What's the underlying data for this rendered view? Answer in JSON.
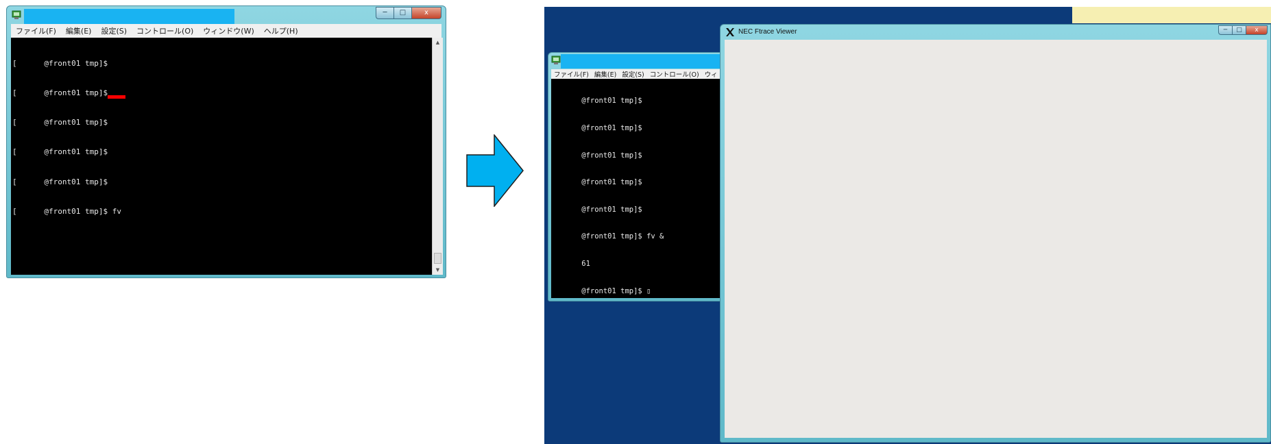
{
  "terminal_window": {
    "menu": [
      "ファイル(F)",
      "編集(E)",
      "設定(S)",
      "コントロール(O)",
      "ウィンドウ(W)",
      "ヘルプ(H)"
    ],
    "lines": [
      "[      @front01 tmp]$",
      "[      @front01 tmp]$",
      "[      @front01 tmp]$",
      "[      @front01 tmp]$",
      "[      @front01 tmp]$",
      "[      @front01 tmp]$ fv"
    ],
    "controls": {
      "minimize": "─",
      "maximize": "□",
      "close": "x"
    },
    "scroll_up": "▲",
    "scroll_down": "▼",
    "highlight_color": "#ff0000"
  },
  "arrow": {
    "color": "#00b0f0"
  },
  "desktop": {
    "background": "#0c3a79"
  },
  "back_terminal_window": {
    "menu": [
      "ファイル(F)",
      "編集(E)",
      "設定(S)",
      "コントロール(O)",
      "ウィ"
    ],
    "lines": [
      "       @front01 tmp]$",
      "       @front01 tmp]$",
      "       @front01 tmp]$",
      "       @front01 tmp]$",
      "       @front01 tmp]$",
      "       @front01 tmp]$ fv &",
      "       61",
      "       @front01 tmp]$ ▯"
    ]
  },
  "viewer_window": {
    "title": "NEC Ftrace Viewer",
    "controls": {
      "minimize": "─",
      "maximize": "□",
      "close": "x"
    }
  }
}
